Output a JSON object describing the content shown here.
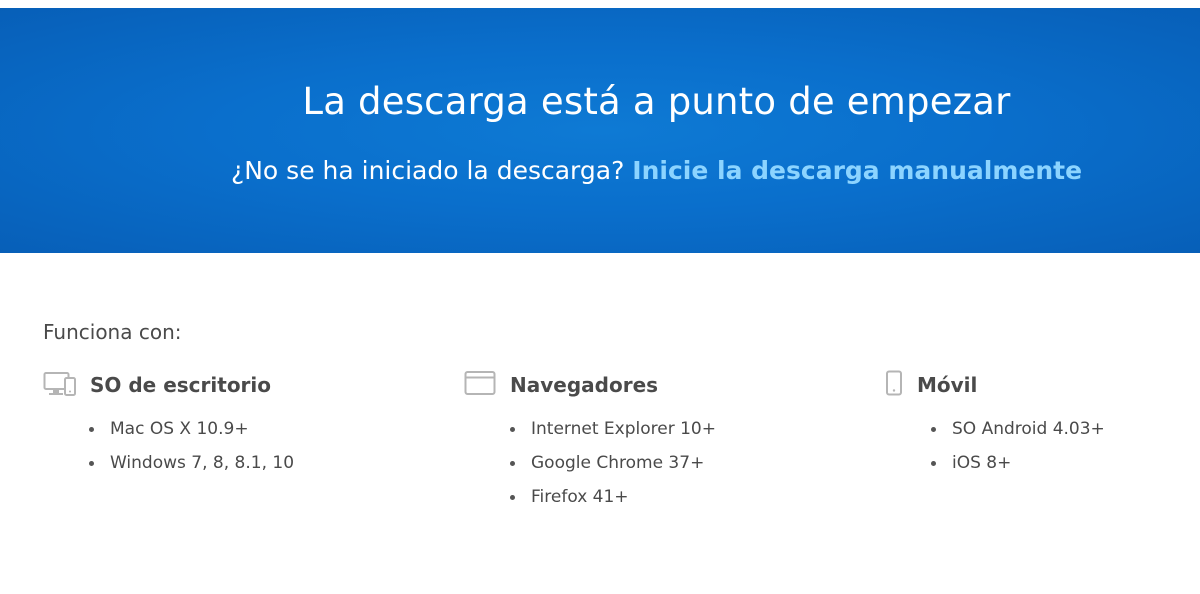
{
  "hero": {
    "title": "La descarga está a punto de empezar",
    "subtitle_prefix": "¿No se ha iniciado la descarga? ",
    "manual_link": "Inicie la descarga manualmente"
  },
  "compat": {
    "heading": "Funciona con:",
    "columns": [
      {
        "icon": "desktop-icon",
        "title": "SO de escritorio",
        "items": [
          "Mac OS X 10.9+",
          "Windows 7, 8, 8.1, 10"
        ]
      },
      {
        "icon": "browser-icon",
        "title": "Navegadores",
        "items": [
          "Internet Explorer 10+",
          "Google Chrome 37+",
          "Firefox 41+"
        ]
      },
      {
        "icon": "mobile-icon",
        "title": "Móvil",
        "items": [
          "SO Android 4.03+",
          "iOS 8+"
        ]
      }
    ]
  },
  "colors": {
    "hero_bg": "#0a6fcc",
    "link": "#8cd4ff",
    "text": "#4a4a4a",
    "icon": "#b5b5b5"
  }
}
